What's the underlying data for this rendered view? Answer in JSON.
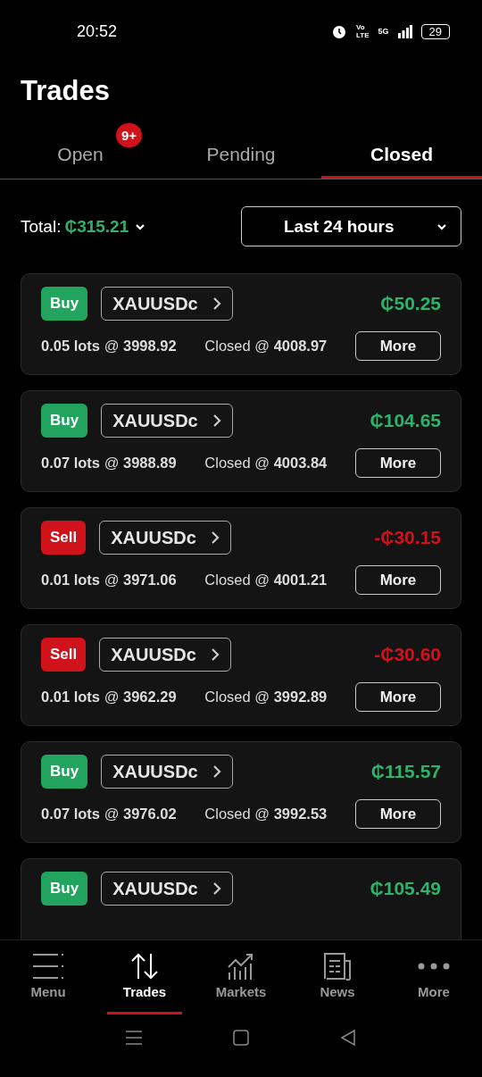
{
  "status_bar": {
    "time": "20:52",
    "volte": [
      "Vo",
      "LTE"
    ],
    "network": "5G",
    "battery": "29"
  },
  "title": "Trades",
  "tabs": [
    {
      "label": "Open",
      "selected": false,
      "badge": "9+"
    },
    {
      "label": "Pending",
      "selected": false
    },
    {
      "label": "Closed",
      "selected": true
    }
  ],
  "summary": {
    "total_label": "Total:",
    "total_value": "₵315.21",
    "period": "Last 24 hours"
  },
  "trades": [
    {
      "side": "Buy",
      "kind": "buy",
      "symbol": "XAUUSDc",
      "profit": "₵50.25",
      "lots": "**0.05 lots** @ **3998.92**",
      "closed": "Closed @ **4008.97**",
      "more": "More"
    },
    {
      "side": "Buy",
      "kind": "buy",
      "symbol": "XAUUSDc",
      "profit": "₵104.65",
      "lots": "**0.07 lots** @ **3988.89**",
      "closed": "Closed @ **4003.84**",
      "more": "More"
    },
    {
      "side": "Sell",
      "kind": "sell",
      "symbol": "XAUUSDc",
      "profit": "-₵30.15",
      "lots": "**0.01 lots** @ **3971.06**",
      "closed": "Closed @ **4001.21**",
      "more": "More"
    },
    {
      "side": "Sell",
      "kind": "sell",
      "symbol": "XAUUSDc",
      "profit": "-₵30.60",
      "lots": "**0.01 lots** @ **3962.29**",
      "closed": "Closed @ **3992.89**",
      "more": "More"
    },
    {
      "side": "Buy",
      "kind": "buy",
      "symbol": "XAUUSDc",
      "profit": "₵115.57",
      "lots": "**0.07 lots** @ **3976.02**",
      "closed": "Closed @ **3992.53**",
      "more": "More"
    },
    {
      "side": "Buy",
      "kind": "buy",
      "symbol": "XAUUSDc",
      "profit": "₵105.49"
    }
  ],
  "nav": [
    {
      "label": "Menu",
      "kind": "menu",
      "selected": false
    },
    {
      "label": "Trades",
      "kind": "trades",
      "selected": true
    },
    {
      "label": "Markets",
      "kind": "markets",
      "selected": false
    },
    {
      "label": "News",
      "kind": "news",
      "selected": false
    },
    {
      "label": "More",
      "kind": "more",
      "selected": false
    }
  ]
}
